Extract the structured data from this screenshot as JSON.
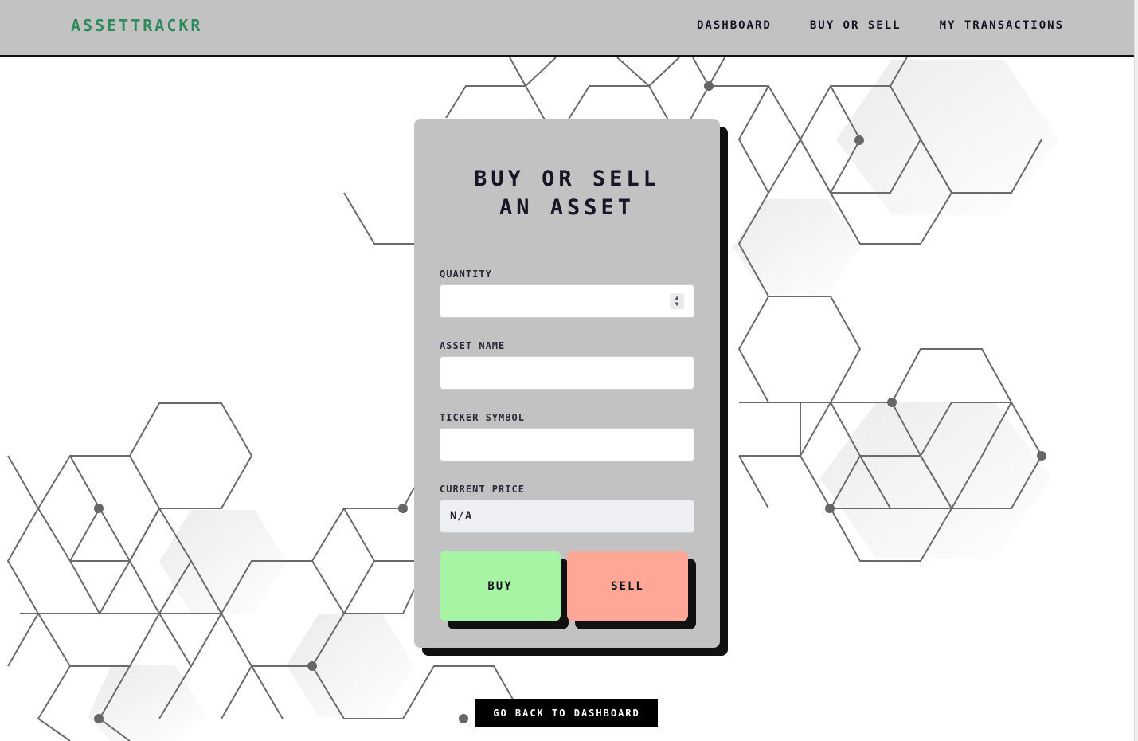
{
  "navbar": {
    "brand": "AssetTrackr",
    "links": [
      "Dashboard",
      "Buy or Sell",
      "My Transactions"
    ]
  },
  "form": {
    "title_line1": "Buy or Sell",
    "title_line2": "an Asset",
    "fields": {
      "quantity": {
        "label": "Quantity",
        "value": ""
      },
      "asset_name": {
        "label": "Asset Name",
        "value": ""
      },
      "ticker_symbol": {
        "label": "Ticker Symbol",
        "value": ""
      },
      "current_price": {
        "label": "Current Price",
        "value": "N/A"
      }
    },
    "buy_label": "Buy",
    "sell_label": "Sell"
  },
  "back_label": "Go back to dashboard",
  "colors": {
    "brand": "#2f8a5e",
    "navbar_bg": "#c2c2c2",
    "card_bg": "#c2c2c2",
    "buy_button": "#a8f4a5",
    "sell_button": "#ffa797",
    "shadow": "#111111"
  }
}
